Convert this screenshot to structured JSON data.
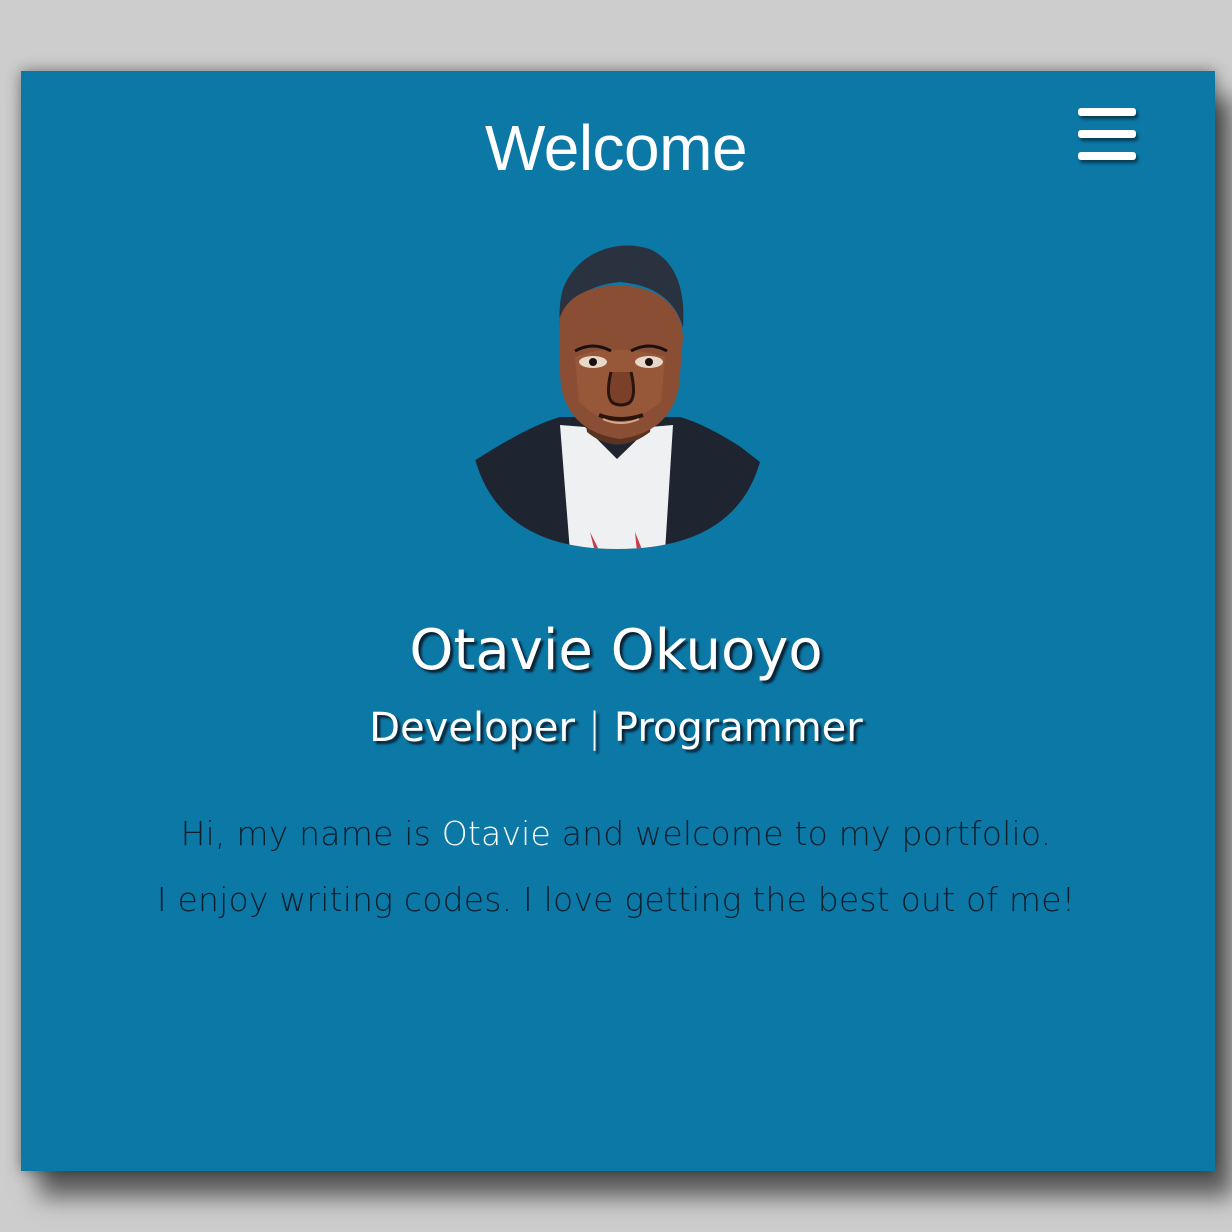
{
  "header": {
    "title": "Welcome",
    "menu_icon": "hamburger-menu-icon"
  },
  "profile": {
    "avatar_alt": "Otavie Okuoyo",
    "name": "Otavie Okuoyo",
    "role_primary": "Developer",
    "role_separator": "|",
    "role_secondary": "Programmer"
  },
  "intro": {
    "line1_prefix": "Hi, my name is ",
    "line1_highlight": "Otavie",
    "line1_suffix": " and welcome to my portfolio.",
    "line2": "I enjoy writing codes. I love getting the best out of me!"
  },
  "colors": {
    "page_background": "#cdcdcd",
    "card_background": "#0b78a6",
    "heading_text": "#ffffff",
    "body_text": "#0e1e2d",
    "text_shadow": "#0c2233"
  }
}
